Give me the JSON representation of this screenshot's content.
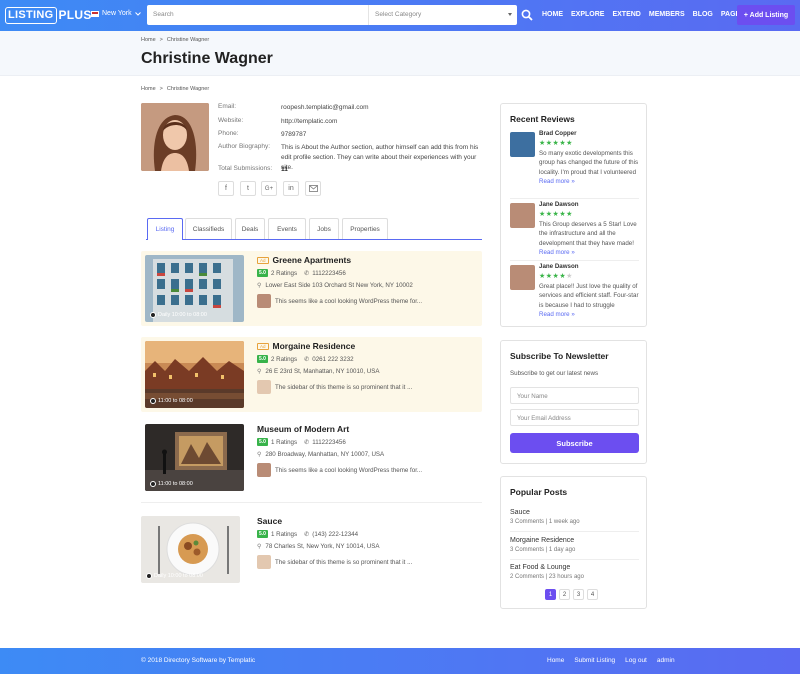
{
  "header": {
    "logo_part1": "LISTING",
    "logo_part2": "PLUS",
    "location": "New York",
    "search_placeholder": "Search",
    "category_placeholder": "Select Category",
    "nav": [
      "HOME",
      "EXPLORE",
      "EXTEND",
      "MEMBERS",
      "BLOG",
      "PAGES"
    ],
    "add_listing": "+ Add Listing",
    "brand_color": "#5a6af2",
    "accent_color": "#6c4ef0"
  },
  "breadcrumb": {
    "home": "Home",
    "sep": ">",
    "current": "Christine Wagner"
  },
  "page_title": "Christine Wagner",
  "author": {
    "fields": [
      {
        "label": "Email:",
        "value": "roopesh.templatic@gmail.com"
      },
      {
        "label": "Website:",
        "value": "http://templatic.com"
      },
      {
        "label": "Phone:",
        "value": "9789787"
      },
      {
        "label": "Author Biography:",
        "value": "This is About the Author section, author himself can add this from his edit profile section. They can write about their experiences with your site."
      },
      {
        "label": "Total Submissions:",
        "value": "11"
      }
    ],
    "social": [
      "f",
      "t",
      "G+",
      "in",
      "mail"
    ]
  },
  "tabs": [
    "Listing",
    "Classifieds",
    "Deals",
    "Events",
    "Jobs",
    "Properties"
  ],
  "listings": [
    {
      "title": "Greene Apartments",
      "ad": "Ad",
      "rating": "5.0",
      "ratings": "2 Ratings",
      "phone": "1112223456",
      "address": "Lower East Side 103 Orchard St New York, NY 10002",
      "review": "This seems like a cool looking WordPress theme for...",
      "hours": "Daily 10:00 to 08:00",
      "highlight": true
    },
    {
      "title": "Morgaine Residence",
      "ad": "Ad",
      "rating": "5.0",
      "ratings": "2 Ratings",
      "phone": "0261 222 3232",
      "address": "26 E 23rd St, Manhattan, NY 10010, USA",
      "review": "The sidebar of this theme is so prominent that it ...",
      "hours": "11:00 to 08:00",
      "highlight": true
    },
    {
      "title": "Museum of Modern Art",
      "ad": "",
      "rating": "5.0",
      "ratings": "1 Ratings",
      "phone": "1112223456",
      "address": "280 Broadway, Manhattan, NY 10007, USA",
      "review": "This seems like a cool looking WordPress theme for...",
      "hours": "11:00 to 08:00",
      "highlight": false
    },
    {
      "title": "Sauce",
      "ad": "",
      "rating": "5.0",
      "ratings": "1 Ratings",
      "phone": "(143) 222-12344",
      "address": "78 Charles St, New York, NY 10014, USA",
      "review": "The sidebar of this theme is so prominent that it ...",
      "hours": "Daily 10:00 to 08:00",
      "highlight": false
    }
  ],
  "recent_reviews": {
    "title": "Recent Reviews",
    "items": [
      {
        "name": "Brad Copper",
        "stars": 5,
        "text": "So many exotic developments this group has changed the future of this locality. I'm proud that I volunteered",
        "more": "Read more »"
      },
      {
        "name": "Jane Dawson",
        "stars": 5,
        "text": "This Group deserves a 5 Star! Love the infrastructure and all the development that they have made!",
        "more": "Read more »"
      },
      {
        "name": "Jane Dawson",
        "stars": 4,
        "text": "Great place!! Just love the quality of services and efficient staff. Four-star is because I had to struggle",
        "more": "Read more »"
      }
    ]
  },
  "newsletter": {
    "title": "Subscribe To Newsletter",
    "subtitle": "Subscribe to get our latest news",
    "name_placeholder": "Your Name",
    "email_placeholder": "Your Email Address",
    "button": "Subscribe"
  },
  "popular_posts": {
    "title": "Popular Posts",
    "items": [
      {
        "title": "Sauce",
        "comments": "3 Comments",
        "time": "1 week ago"
      },
      {
        "title": "Morgaine Residence",
        "comments": "3 Comments",
        "time": "1 day ago"
      },
      {
        "title": "Eat Food & Lounge",
        "comments": "2 Comments",
        "time": "23 hours ago"
      }
    ],
    "pages": [
      "1",
      "2",
      "3",
      "4"
    ],
    "current_page": "1"
  },
  "footer": {
    "copyright": "© 2018 Directory Software by Templatic",
    "links": [
      "Home",
      "Submit Listing",
      "Log out",
      "admin"
    ]
  }
}
